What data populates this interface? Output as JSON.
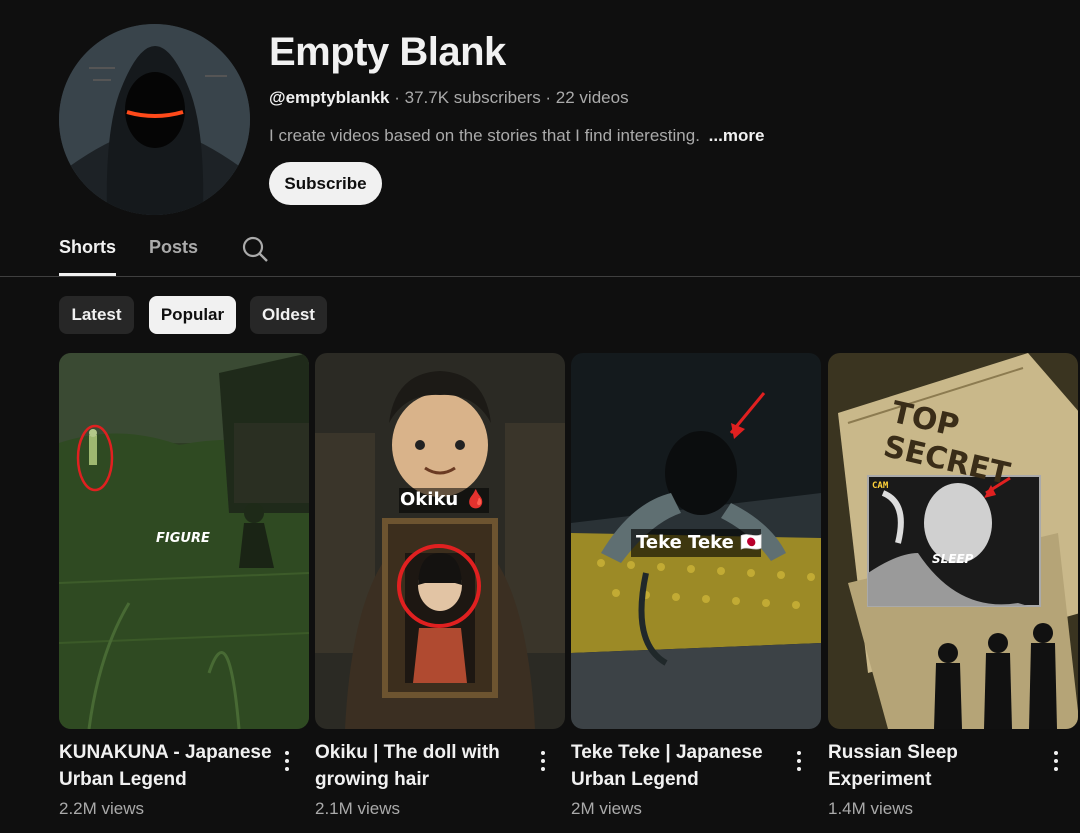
{
  "channel": {
    "name": "Empty Blank",
    "handle": "@emptyblankk",
    "stats": " · 37.7K subscribers · 22 videos",
    "description": "I create videos based on the stories that I find interesting.",
    "more_label": "...more",
    "subscribe_label": "Subscribe"
  },
  "tabs": [
    {
      "label": "Shorts",
      "active": true
    },
    {
      "label": "Posts",
      "active": false
    }
  ],
  "tab_search_icon": "search-icon",
  "sort_chips": [
    {
      "label": "Latest",
      "selected": false
    },
    {
      "label": "Popular",
      "selected": true
    },
    {
      "label": "Oldest",
      "selected": false
    }
  ],
  "videos": [
    {
      "title": "KUNAKUNA - Japanese Urban Legend",
      "views": "2.2M views",
      "overlay": "FIGURE"
    },
    {
      "title": "Okiku | The doll with growing hair",
      "views": "2.1M views",
      "overlay": "Okiku 🩸"
    },
    {
      "title": "Teke Teke | Japanese Urban Legend",
      "views": "2M views",
      "overlay": "Teke Teke 🇯🇵"
    },
    {
      "title": "Russian Sleep Experiment",
      "views": "1.4M views",
      "overlay": "SLEEP",
      "stamp": "TOP SECRET",
      "cam": "CAM"
    }
  ],
  "colors": {
    "background": "#0f0f0f",
    "text": "#f1f1f1",
    "muted": "#aaaaaa",
    "chip": "#272727",
    "accent_red": "#e02020"
  }
}
